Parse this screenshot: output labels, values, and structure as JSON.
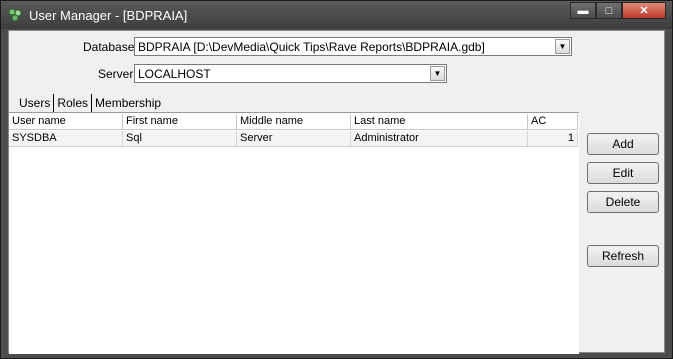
{
  "window": {
    "title": "User Manager - [BDPRAIA]"
  },
  "form": {
    "database_label": "Database",
    "database_value": "BDPRAIA [D:\\DevMedia\\Quick Tips\\Rave Reports\\BDPRAIA.gdb]",
    "server_label": "Server",
    "server_value": "LOCALHOST"
  },
  "tabs": [
    {
      "label": "Users"
    },
    {
      "label": "Roles"
    },
    {
      "label": "Membership"
    }
  ],
  "table": {
    "columns": [
      "User name",
      "First name",
      "Middle name",
      "Last name",
      "AC"
    ],
    "rows": [
      [
        "SYSDBA",
        "Sql",
        "Server",
        "Administrator",
        "1"
      ]
    ]
  },
  "buttons": {
    "add": "Add",
    "edit": "Edit",
    "delete": "Delete",
    "refresh": "Refresh"
  },
  "icons": {
    "app": "users-icon",
    "minimize": "minimize-icon",
    "maximize": "maximize-icon",
    "close": "close-icon",
    "dropdown": "chevron-down-icon"
  }
}
